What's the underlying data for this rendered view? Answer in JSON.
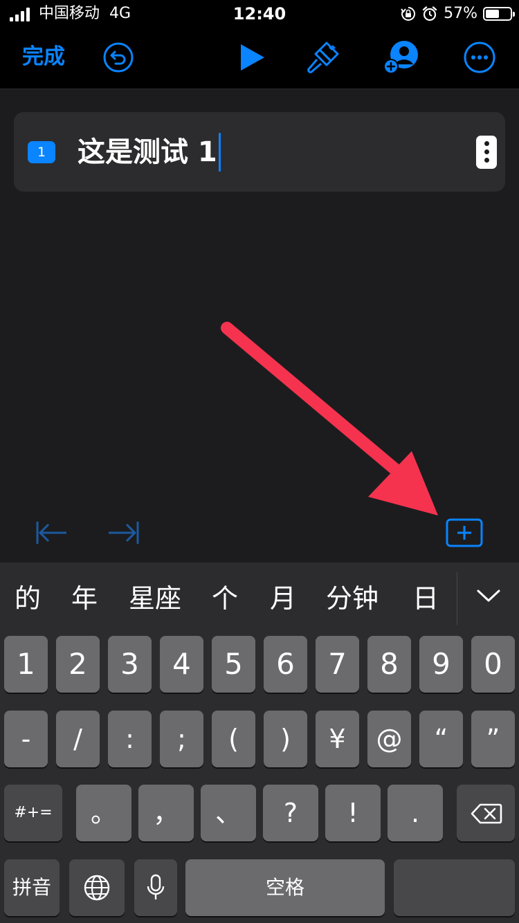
{
  "status_bar": {
    "carrier": "中国移动",
    "network": "4G",
    "time": "12:40",
    "battery_percent_label": "57%",
    "battery_level": 0.57
  },
  "nav": {
    "done_label": "完成",
    "accent_color": "#0a84ff"
  },
  "action": {
    "index": "1",
    "text": "这是测试 1"
  },
  "annotation": {
    "arrow_color": "#f5334f"
  },
  "keyboard": {
    "candidates": [
      "的",
      "年",
      "星座",
      "个",
      "月",
      "分钟",
      "日"
    ],
    "row1": [
      "1",
      "2",
      "3",
      "4",
      "5",
      "6",
      "7",
      "8",
      "9",
      "0"
    ],
    "row2": [
      "-",
      "/",
      ":",
      ";",
      "(",
      ")",
      "¥",
      "@",
      "“",
      "”"
    ],
    "row3_mode_label": "#+=",
    "row3": [
      "。",
      "，",
      "、",
      "?",
      "!",
      "."
    ],
    "pinyin_label": "拼音",
    "space_label": "空格"
  }
}
